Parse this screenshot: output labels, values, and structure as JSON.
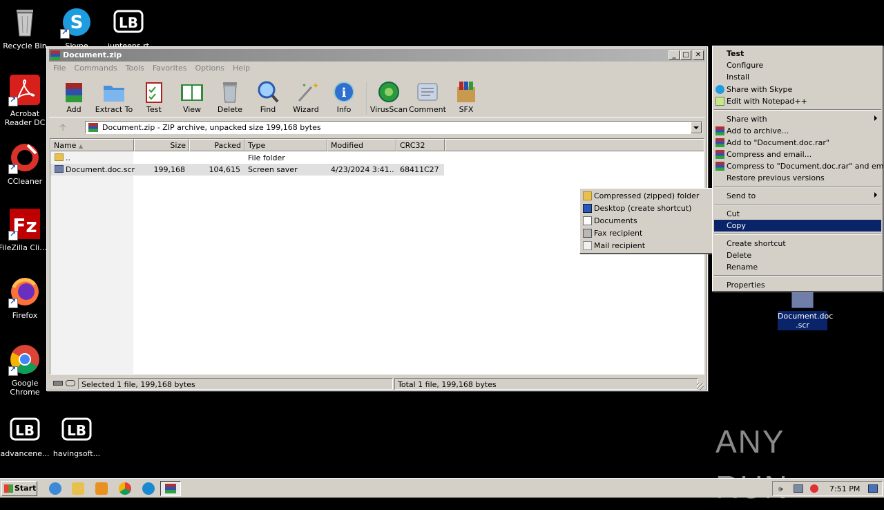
{
  "desktop": {
    "icons": [
      {
        "label": "Recycle Bin"
      },
      {
        "label": "Skype"
      },
      {
        "label": "iupteeps.rt"
      },
      {
        "label": "Acrobat Reader DC"
      },
      {
        "label": "CCleaner"
      },
      {
        "label": "FileZilla Client"
      },
      {
        "label": "Firefox"
      },
      {
        "label": "Google Chrome"
      },
      {
        "label": "advancene..."
      },
      {
        "label": "havingsoft..."
      }
    ],
    "selected_file_label_1": "Document.doc",
    "selected_file_label_2": ".scr",
    "watermark": "ANY RUN"
  },
  "window": {
    "title": "Document.zip",
    "menu": [
      "File",
      "Commands",
      "Tools",
      "Favorites",
      "Options",
      "Help"
    ],
    "toolbar": [
      "Add",
      "Extract To",
      "Test",
      "View",
      "Delete",
      "Find",
      "Wizard",
      "Info",
      "VirusScan",
      "Comment",
      "SFX"
    ],
    "address": "Document.zip - ZIP archive, unpacked size 199,168 bytes",
    "columns": [
      "Name",
      "Size",
      "Packed",
      "Type",
      "Modified",
      "CRC32"
    ],
    "rows": [
      {
        "name": "..",
        "size": "",
        "packed": "",
        "type": "File folder",
        "modified": "",
        "crc": ""
      },
      {
        "name": "Document.doc.scr",
        "size": "199,168",
        "packed": "104,615",
        "type": "Screen saver",
        "modified": "4/23/2024 3:41...",
        "crc": "68411C27"
      }
    ],
    "status_left": "Selected 1 file, 199,168 bytes",
    "status_right": "Total 1 file, 199,168 bytes"
  },
  "context_menu": {
    "items": [
      {
        "label": "Test",
        "bold": true
      },
      {
        "label": "Configure"
      },
      {
        "label": "Install"
      },
      {
        "label": "Share with Skype"
      },
      {
        "label": "Edit with Notepad++"
      },
      {
        "label": "Share with"
      },
      {
        "label": "Add to archive..."
      },
      {
        "label": "Add to \"Document.doc.rar\""
      },
      {
        "label": "Compress and email..."
      },
      {
        "label": "Compress to \"Document.doc.rar\" and email"
      },
      {
        "label": "Restore previous versions"
      },
      {
        "label": "Send to"
      },
      {
        "label": "Cut"
      },
      {
        "label": "Copy"
      },
      {
        "label": "Create shortcut"
      },
      {
        "label": "Delete"
      },
      {
        "label": "Rename"
      },
      {
        "label": "Properties"
      }
    ],
    "selected_item": "Copy"
  },
  "sendto_menu": {
    "items": [
      "Compressed (zipped) folder",
      "Desktop (create shortcut)",
      "Documents",
      "Fax recipient",
      "Mail recipient"
    ]
  },
  "taskbar": {
    "start": "Start",
    "clock": "7:51 PM"
  }
}
